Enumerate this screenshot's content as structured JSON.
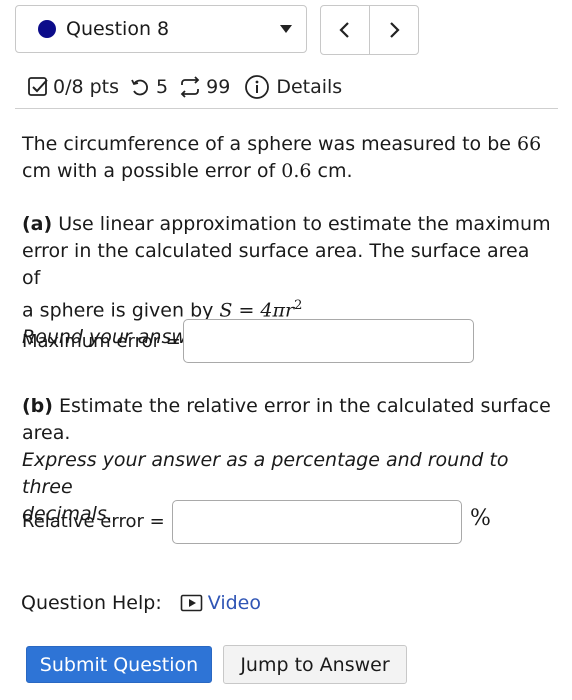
{
  "header": {
    "question_selector": "Question 8",
    "prev_icon": "chevron-left-icon",
    "next_icon": "chevron-right-icon"
  },
  "meta": {
    "points": "0/8 pts",
    "retries": "5",
    "submissions": "99",
    "details": "Details"
  },
  "question": {
    "intro_a": "The circumference of a sphere was measured to be ",
    "circumference": "66",
    "intro_b": "cm with a possible error of ",
    "error_value": "0.6",
    "intro_c": " cm.",
    "part_a": {
      "label": "(a)",
      "text_1": " Use linear approximation to estimate the maximum",
      "text_2": "error in the calculated surface area. The surface area of",
      "text_3": "a sphere is given by ",
      "formula": "S = 4πr",
      "formula_exp": "2",
      "instruction": "Round your answer to three decimals.",
      "field_label": "Maximum error =",
      "field_value": ""
    },
    "part_b": {
      "label": "(b)",
      "text_1": " Estimate the relative error in the calculated surface",
      "text_2": "area.",
      "instruction_1": "Express your answer as a percentage and round to three",
      "instruction_2": "decimals.",
      "field_label": "Relative error =",
      "field_value": "",
      "unit": "%"
    }
  },
  "help": {
    "label": "Question Help:",
    "video": "Video"
  },
  "buttons": {
    "submit": "Submit Question",
    "jump": "Jump to Answer"
  },
  "colors": {
    "accent": "#2e74d6",
    "selector_dot": "#0c0c8a",
    "link": "#2f55b5"
  }
}
